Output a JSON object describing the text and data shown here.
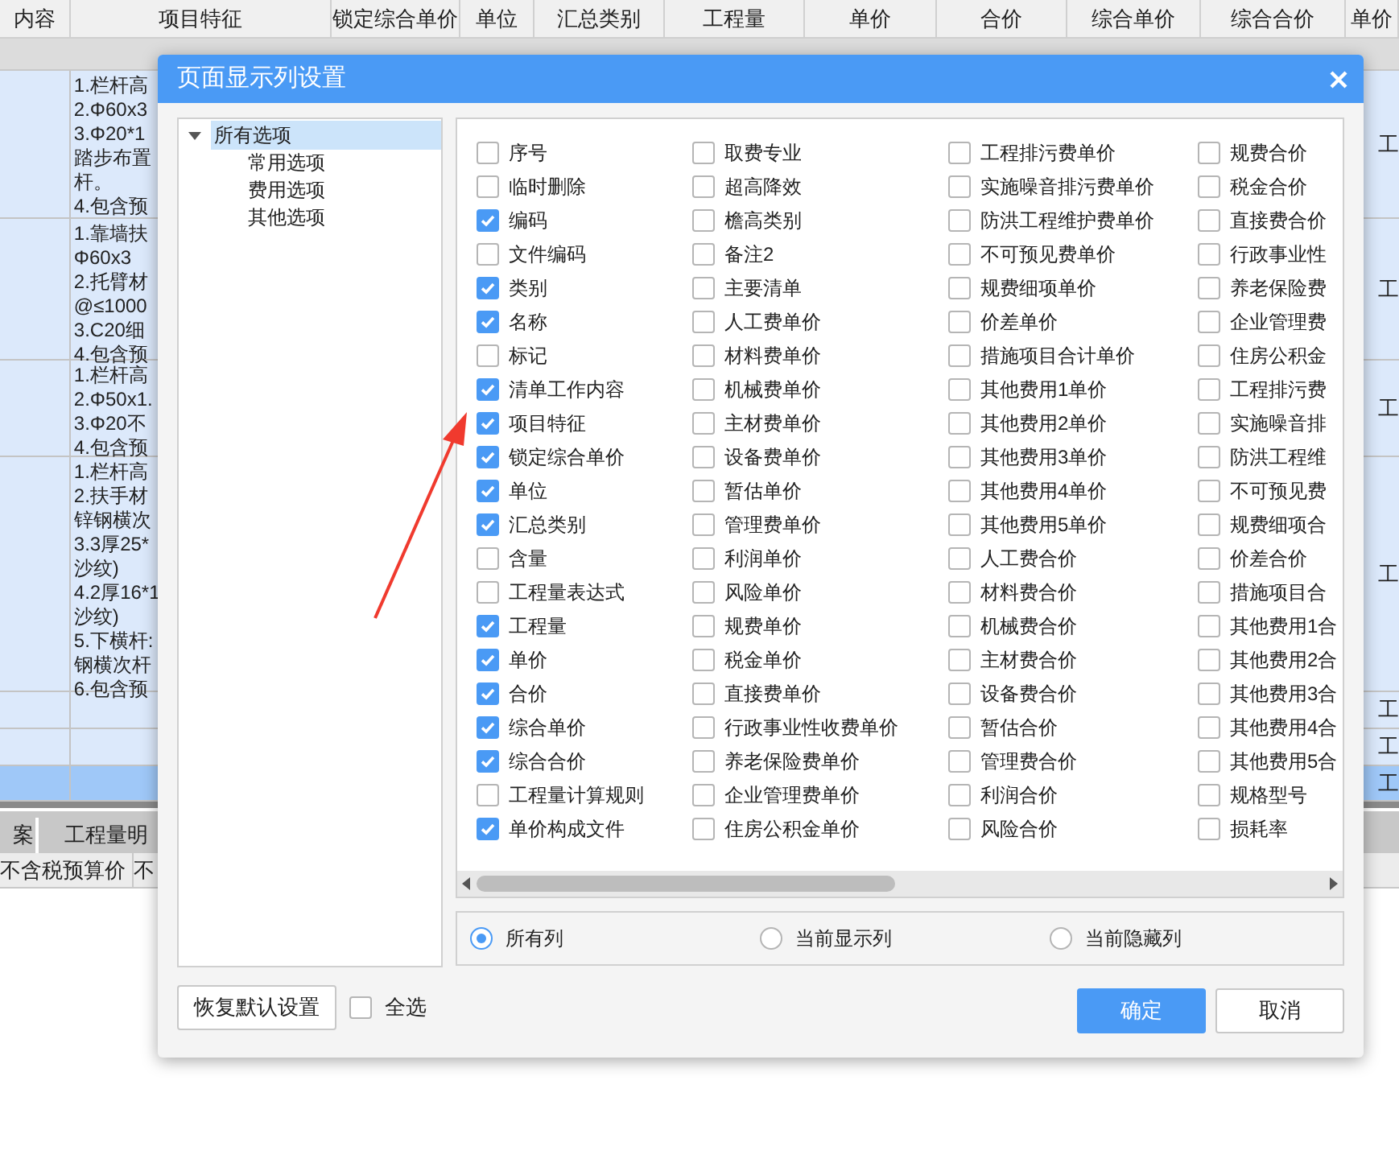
{
  "table": {
    "columns": [
      "内容",
      "项目特征",
      "锁定综合单价",
      "单位",
      "汇总类别",
      "工程量",
      "单价",
      "合价",
      "综合单价",
      "综合合价",
      "单价"
    ],
    "rows": [
      {
        "feature": [
          "1.栏杆高",
          "2.Φ60x3",
          "3.Φ20*1",
          "踏步布置",
          "杆。",
          "4.包含预"
        ],
        "last": "工",
        "selected": false
      },
      {
        "feature": [
          "1.靠墙扶",
          "Φ60x3",
          "2.托臂材",
          "@≤1000",
          "3.C20细",
          "4.包含预"
        ],
        "last": "工",
        "selected": false
      },
      {
        "feature": [
          "1.栏杆高",
          "2.Φ50x1.",
          "3.Φ20不",
          "4.包含预"
        ],
        "last": "工",
        "selected": false
      },
      {
        "feature": [
          "1.栏杆高",
          "2.扶手材",
          "锌钢横次",
          "3.3厚25*",
          "沙纹)",
          "4.2厚16*1",
          "沙纹)",
          "5.下横杆:",
          "钢横次杆",
          "6.包含预"
        ],
        "last": "工",
        "selected": false
      },
      {
        "feature": [],
        "last": "工",
        "selected": false
      },
      {
        "feature": [],
        "last": "工",
        "selected": false
      },
      {
        "feature": [],
        "last": "工",
        "selected": true
      }
    ]
  },
  "bottom_tabs": [
    {
      "label": "案"
    },
    {
      "label": "工程量明"
    }
  ],
  "bottom_columns": [
    "不含税预算价",
    "不"
  ],
  "dialog": {
    "title": "页面显示列设置",
    "tree": {
      "label": "所有选项",
      "expanded": true,
      "selected": true,
      "children": [
        {
          "label": "常用选项",
          "selected": false
        },
        {
          "label": "费用选项",
          "selected": false
        },
        {
          "label": "其他选项",
          "selected": false
        }
      ]
    },
    "option_columns": [
      {
        "items": [
          {
            "label": "序号",
            "checked": false
          },
          {
            "label": "临时删除",
            "checked": false
          },
          {
            "label": "编码",
            "checked": true
          },
          {
            "label": "文件编码",
            "checked": false
          },
          {
            "label": "类别",
            "checked": true
          },
          {
            "label": "名称",
            "checked": true
          },
          {
            "label": "标记",
            "checked": false
          },
          {
            "label": "清单工作内容",
            "checked": true
          },
          {
            "label": "项目特征",
            "checked": true
          },
          {
            "label": "锁定综合单价",
            "checked": true
          },
          {
            "label": "单位",
            "checked": true
          },
          {
            "label": "汇总类别",
            "checked": true
          },
          {
            "label": "含量",
            "checked": false
          },
          {
            "label": "工程量表达式",
            "checked": false
          },
          {
            "label": "工程量",
            "checked": true
          },
          {
            "label": "单价",
            "checked": true
          },
          {
            "label": "合价",
            "checked": true
          },
          {
            "label": "综合单价",
            "checked": true
          },
          {
            "label": "综合合价",
            "checked": true
          },
          {
            "label": "工程量计算规则",
            "checked": false
          },
          {
            "label": "单价构成文件",
            "checked": true
          }
        ]
      },
      {
        "items": [
          {
            "label": "取费专业",
            "checked": false
          },
          {
            "label": "超高降效",
            "checked": false
          },
          {
            "label": "檐高类别",
            "checked": false
          },
          {
            "label": "备注2",
            "checked": false
          },
          {
            "label": "主要清单",
            "checked": false
          },
          {
            "label": "人工费单价",
            "checked": false
          },
          {
            "label": "材料费单价",
            "checked": false
          },
          {
            "label": "机械费单价",
            "checked": false
          },
          {
            "label": "主材费单价",
            "checked": false
          },
          {
            "label": "设备费单价",
            "checked": false
          },
          {
            "label": "暂估单价",
            "checked": false
          },
          {
            "label": "管理费单价",
            "checked": false
          },
          {
            "label": "利润单价",
            "checked": false
          },
          {
            "label": "风险单价",
            "checked": false
          },
          {
            "label": "规费单价",
            "checked": false
          },
          {
            "label": "税金单价",
            "checked": false
          },
          {
            "label": "直接费单价",
            "checked": false
          },
          {
            "label": "行政事业性收费单价",
            "checked": false
          },
          {
            "label": "养老保险费单价",
            "checked": false
          },
          {
            "label": "企业管理费单价",
            "checked": false
          },
          {
            "label": "住房公积金单价",
            "checked": false
          }
        ]
      },
      {
        "items": [
          {
            "label": "工程排污费单价",
            "checked": false
          },
          {
            "label": "实施噪音排污费单价",
            "checked": false
          },
          {
            "label": "防洪工程维护费单价",
            "checked": false
          },
          {
            "label": "不可预见费单价",
            "checked": false
          },
          {
            "label": "规费细项单价",
            "checked": false
          },
          {
            "label": "价差单价",
            "checked": false
          },
          {
            "label": "措施项目合计单价",
            "checked": false
          },
          {
            "label": "其他费用1单价",
            "checked": false
          },
          {
            "label": "其他费用2单价",
            "checked": false
          },
          {
            "label": "其他费用3单价",
            "checked": false
          },
          {
            "label": "其他费用4单价",
            "checked": false
          },
          {
            "label": "其他费用5单价",
            "checked": false
          },
          {
            "label": "人工费合价",
            "checked": false
          },
          {
            "label": "材料费合价",
            "checked": false
          },
          {
            "label": "机械费合价",
            "checked": false
          },
          {
            "label": "主材费合价",
            "checked": false
          },
          {
            "label": "设备费合价",
            "checked": false
          },
          {
            "label": "暂估合价",
            "checked": false
          },
          {
            "label": "管理费合价",
            "checked": false
          },
          {
            "label": "利润合价",
            "checked": false
          },
          {
            "label": "风险合价",
            "checked": false
          }
        ]
      },
      {
        "items": [
          {
            "label": "规费合价",
            "checked": false
          },
          {
            "label": "税金合价",
            "checked": false
          },
          {
            "label": "直接费合价",
            "checked": false
          },
          {
            "label": "行政事业性",
            "checked": false
          },
          {
            "label": "养老保险费",
            "checked": false
          },
          {
            "label": "企业管理费",
            "checked": false
          },
          {
            "label": "住房公积金",
            "checked": false
          },
          {
            "label": "工程排污费",
            "checked": false
          },
          {
            "label": "实施噪音排",
            "checked": false
          },
          {
            "label": "防洪工程维",
            "checked": false
          },
          {
            "label": "不可预见费",
            "checked": false
          },
          {
            "label": "规费细项合",
            "checked": false
          },
          {
            "label": "价差合价",
            "checked": false
          },
          {
            "label": "措施项目合",
            "checked": false
          },
          {
            "label": "其他费用1合",
            "checked": false
          },
          {
            "label": "其他费用2合",
            "checked": false
          },
          {
            "label": "其他费用3合",
            "checked": false
          },
          {
            "label": "其他费用4合",
            "checked": false
          },
          {
            "label": "其他费用5合",
            "checked": false
          },
          {
            "label": "规格型号",
            "checked": false
          },
          {
            "label": "损耗率",
            "checked": false
          }
        ]
      }
    ],
    "filters": [
      {
        "label": "所有列",
        "selected": true
      },
      {
        "label": "当前显示列",
        "selected": false
      },
      {
        "label": "当前隐藏列",
        "selected": false
      }
    ],
    "restore_button": "恢复默认设置",
    "select_all": {
      "label": "全选",
      "checked": false
    },
    "ok_button": "确定",
    "cancel_button": "取消"
  }
}
